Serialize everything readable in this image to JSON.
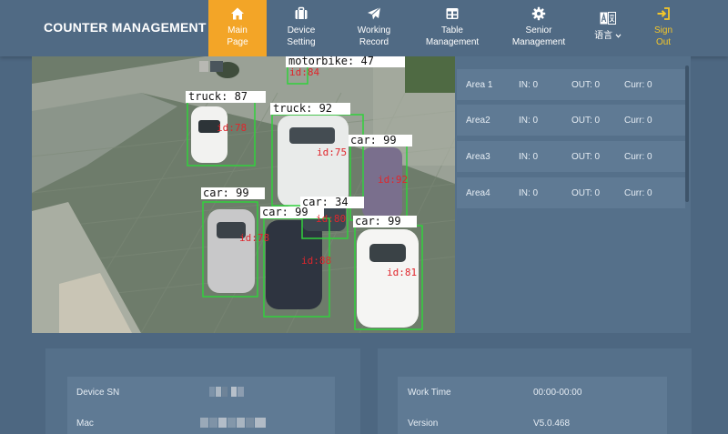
{
  "header": {
    "brand": "COUNTER MANAGEMENT",
    "nav": [
      {
        "line1": "Main",
        "line2": "Page",
        "icon": "home-icon"
      },
      {
        "line1": "Device",
        "line2": "Setting",
        "icon": "briefcase-icon"
      },
      {
        "line1": "Working",
        "line2": "Record",
        "icon": "send-icon"
      },
      {
        "line1": "Table",
        "line2": "Management",
        "icon": "table-icon"
      },
      {
        "line1": "Senior",
        "line2": "Management",
        "icon": "gear-icon"
      }
    ],
    "language": "语言",
    "signout": {
      "line1": "Sign",
      "line2": "Out"
    }
  },
  "video": {
    "detections": [
      {
        "label": "motorbike: 47",
        "id": "id:84"
      },
      {
        "label": "truck: 87",
        "id": "id:78"
      },
      {
        "label": "truck: 92",
        "id": "id:75"
      },
      {
        "label": "car: 99",
        "id": "id:92"
      },
      {
        "label": "car: 99",
        "id": "id:78"
      },
      {
        "label": "car: 34",
        "id": "id:80"
      },
      {
        "label": "car: 99",
        "id": "id:88"
      },
      {
        "label": "car: 99",
        "id": "id:81"
      }
    ]
  },
  "areas": [
    {
      "name": "Area 1",
      "in": "IN: 0",
      "out": "OUT: 0",
      "curr": "Curr: 0"
    },
    {
      "name": "Area2",
      "in": "IN: 0",
      "out": "OUT: 0",
      "curr": "Curr: 0"
    },
    {
      "name": "Area3",
      "in": "IN: 0",
      "out": "OUT: 0",
      "curr": "Curr: 0"
    },
    {
      "name": "Area4",
      "in": "IN: 0",
      "out": "OUT: 0",
      "curr": "Curr: 0"
    }
  ],
  "device_info": {
    "sn_label": "Device SN",
    "mac_label": "Mac"
  },
  "work_info": {
    "time_label": "Work Time",
    "time_value": "00:00-00:00",
    "version_label": "Version",
    "version_value": "V5.0.468"
  },
  "colors": {
    "accent": "#f3a527",
    "signout": "#f3c62a",
    "detect_box": "#31d13c"
  }
}
